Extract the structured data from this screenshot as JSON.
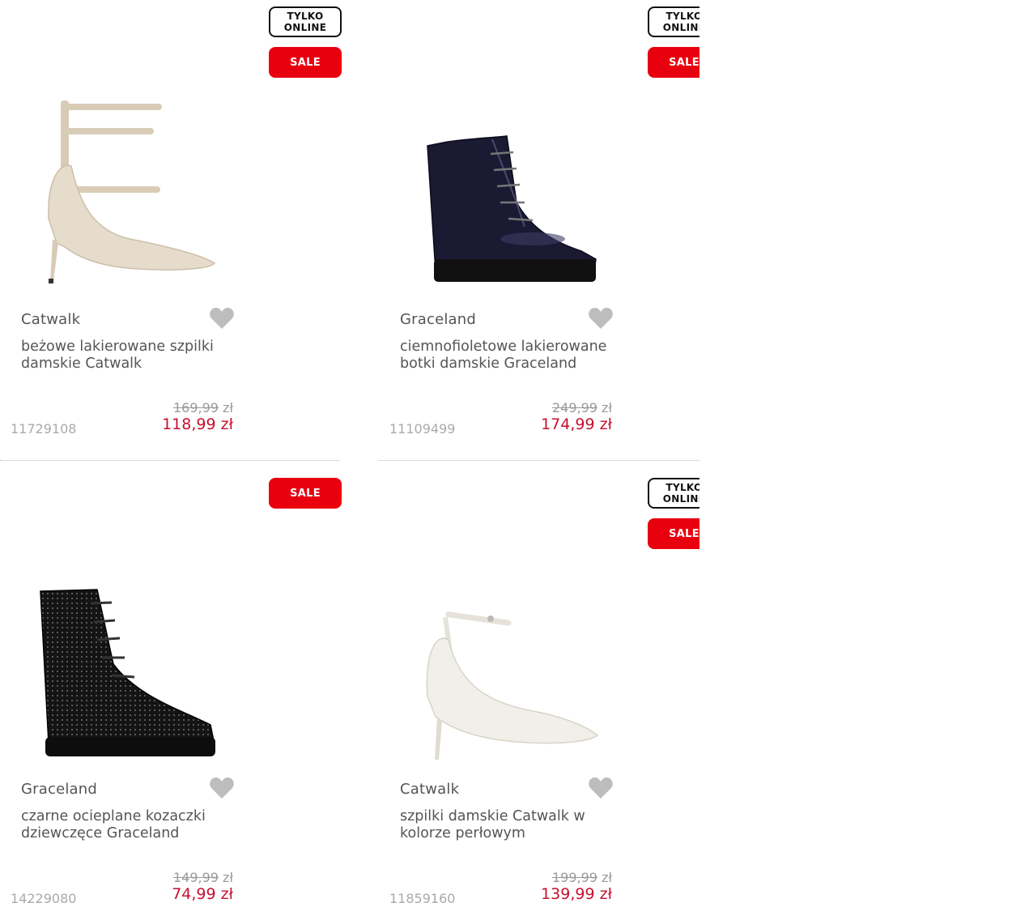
{
  "badges": {
    "online_line1": "TYLKO",
    "online_line2": "ONLINE",
    "sale": "SALE"
  },
  "currency_old": "zł",
  "colors": {
    "sale_red": "#e8000f",
    "price_red": "#c8102e",
    "heart_gray": "#bdbdbd"
  },
  "products": [
    {
      "brand": "Catwalk",
      "name": "beżowe lakierowane szpilki damskie Catwalk",
      "old_price": "169,99",
      "new_price": "118,99 zł",
      "sku": "11729108",
      "tylko_online": true,
      "sale": true,
      "image": "beige-strappy-pump"
    },
    {
      "brand": "Graceland",
      "name": "ciemnofioletowe lakierowane botki damskie Graceland",
      "old_price": "249,99",
      "new_price": "174,99 zł",
      "sku": "11109499",
      "tylko_online": true,
      "sale": true,
      "image": "dark-purple-patent-boot"
    },
    {
      "brand": "Graceland",
      "name": "czarne ocieplane kozaczki dziewczęce Graceland",
      "old_price": "149,99",
      "new_price": "74,99 zł",
      "sku": "14229080",
      "tylko_online": false,
      "sale": true,
      "image": "black-dotted-lace-boot"
    },
    {
      "brand": "Catwalk",
      "name": "szpilki damskie Catwalk w kolorze perłowym",
      "old_price": "199,99",
      "new_price": "139,99 zł",
      "sku": "11859160",
      "tylko_online": true,
      "sale": true,
      "image": "pearl-ankle-strap-pump"
    }
  ]
}
